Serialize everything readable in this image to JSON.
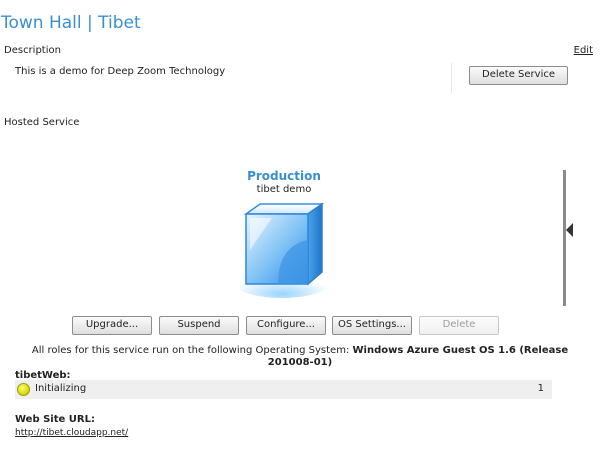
{
  "header": {
    "title": "Town Hall | Tibet",
    "edit_label": "Edit"
  },
  "description": {
    "label": "Description",
    "text": "This is a demo for Deep Zoom Technology"
  },
  "delete_service_label": "Delete Service",
  "hosted_service": {
    "label": "Hosted Service",
    "deployment_name": "Production",
    "deployment_label": "tibet demo"
  },
  "actions": {
    "upgrade": "Upgrade...",
    "suspend": "Suspend",
    "configure": "Configure...",
    "os_settings": "OS Settings...",
    "delete": "Delete"
  },
  "os_info": {
    "prefix": "All roles for this service run on the following Operating System: ",
    "os_name_a": "Windows Azure Guest OS 1.6 (Release",
    "os_name_b": "201008-01)"
  },
  "roles": [
    {
      "name": "tibetWeb:",
      "status": "Initializing",
      "instance_count": "1",
      "status_color": "#e0e000"
    }
  ],
  "website": {
    "label": "Web Site URL:",
    "url": "http://tibet.cloudapp.net/"
  },
  "colors": {
    "accent": "#3a8fce",
    "cube_blue": "#2f8fe6"
  },
  "icons": {
    "cube": "deployment-cube-icon",
    "status": "status-dot-icon",
    "collapse": "triangle-left-icon"
  }
}
